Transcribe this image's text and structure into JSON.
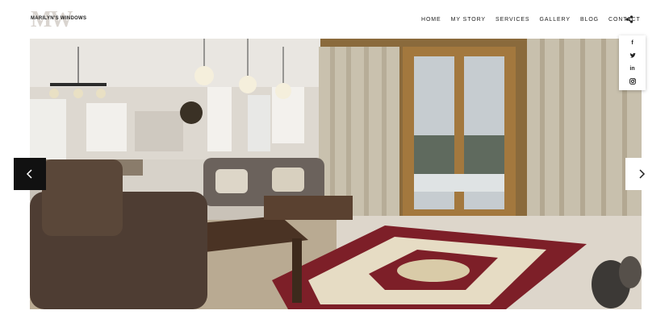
{
  "logo": {
    "mark": "MW",
    "text": "MARILYN'S WINDOWS"
  },
  "nav": {
    "items": [
      {
        "label": "HOME"
      },
      {
        "label": "MY STORY"
      },
      {
        "label": "SERVICES"
      },
      {
        "label": "GALLERY"
      },
      {
        "label": "BLOG"
      },
      {
        "label": "CONTACT"
      }
    ]
  },
  "social": {
    "facebook": "f",
    "twitter": "t",
    "linkedin": "in",
    "instagram": "ig"
  },
  "icons": {
    "share": "share-icon",
    "prev": "chevron-left-icon",
    "next": "chevron-right-icon"
  }
}
